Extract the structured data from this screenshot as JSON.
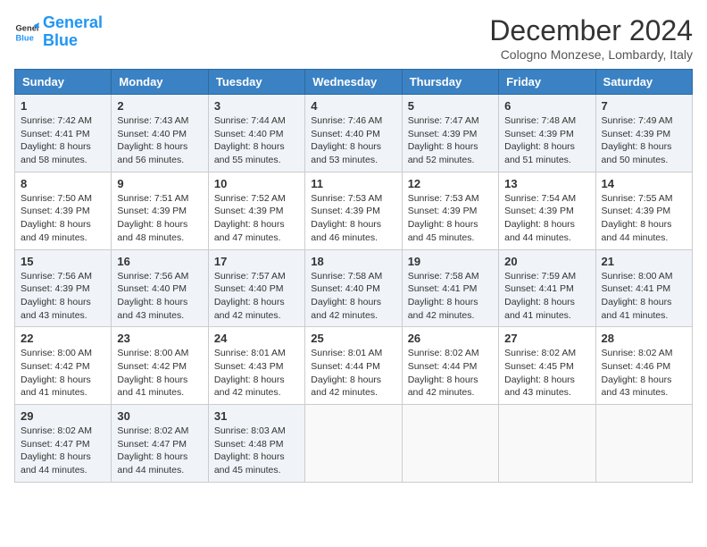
{
  "header": {
    "logo_line1": "General",
    "logo_line2": "Blue",
    "month_title": "December 2024",
    "location": "Cologno Monzese, Lombardy, Italy"
  },
  "weekdays": [
    "Sunday",
    "Monday",
    "Tuesday",
    "Wednesday",
    "Thursday",
    "Friday",
    "Saturday"
  ],
  "weeks": [
    [
      {
        "day": "1",
        "sunrise": "7:42 AM",
        "sunset": "4:41 PM",
        "daylight": "8 hours and 58 minutes."
      },
      {
        "day": "2",
        "sunrise": "7:43 AM",
        "sunset": "4:40 PM",
        "daylight": "8 hours and 56 minutes."
      },
      {
        "day": "3",
        "sunrise": "7:44 AM",
        "sunset": "4:40 PM",
        "daylight": "8 hours and 55 minutes."
      },
      {
        "day": "4",
        "sunrise": "7:46 AM",
        "sunset": "4:40 PM",
        "daylight": "8 hours and 53 minutes."
      },
      {
        "day": "5",
        "sunrise": "7:47 AM",
        "sunset": "4:39 PM",
        "daylight": "8 hours and 52 minutes."
      },
      {
        "day": "6",
        "sunrise": "7:48 AM",
        "sunset": "4:39 PM",
        "daylight": "8 hours and 51 minutes."
      },
      {
        "day": "7",
        "sunrise": "7:49 AM",
        "sunset": "4:39 PM",
        "daylight": "8 hours and 50 minutes."
      }
    ],
    [
      {
        "day": "8",
        "sunrise": "7:50 AM",
        "sunset": "4:39 PM",
        "daylight": "8 hours and 49 minutes."
      },
      {
        "day": "9",
        "sunrise": "7:51 AM",
        "sunset": "4:39 PM",
        "daylight": "8 hours and 48 minutes."
      },
      {
        "day": "10",
        "sunrise": "7:52 AM",
        "sunset": "4:39 PM",
        "daylight": "8 hours and 47 minutes."
      },
      {
        "day": "11",
        "sunrise": "7:53 AM",
        "sunset": "4:39 PM",
        "daylight": "8 hours and 46 minutes."
      },
      {
        "day": "12",
        "sunrise": "7:53 AM",
        "sunset": "4:39 PM",
        "daylight": "8 hours and 45 minutes."
      },
      {
        "day": "13",
        "sunrise": "7:54 AM",
        "sunset": "4:39 PM",
        "daylight": "8 hours and 44 minutes."
      },
      {
        "day": "14",
        "sunrise": "7:55 AM",
        "sunset": "4:39 PM",
        "daylight": "8 hours and 44 minutes."
      }
    ],
    [
      {
        "day": "15",
        "sunrise": "7:56 AM",
        "sunset": "4:39 PM",
        "daylight": "8 hours and 43 minutes."
      },
      {
        "day": "16",
        "sunrise": "7:56 AM",
        "sunset": "4:40 PM",
        "daylight": "8 hours and 43 minutes."
      },
      {
        "day": "17",
        "sunrise": "7:57 AM",
        "sunset": "4:40 PM",
        "daylight": "8 hours and 42 minutes."
      },
      {
        "day": "18",
        "sunrise": "7:58 AM",
        "sunset": "4:40 PM",
        "daylight": "8 hours and 42 minutes."
      },
      {
        "day": "19",
        "sunrise": "7:58 AM",
        "sunset": "4:41 PM",
        "daylight": "8 hours and 42 minutes."
      },
      {
        "day": "20",
        "sunrise": "7:59 AM",
        "sunset": "4:41 PM",
        "daylight": "8 hours and 41 minutes."
      },
      {
        "day": "21",
        "sunrise": "8:00 AM",
        "sunset": "4:41 PM",
        "daylight": "8 hours and 41 minutes."
      }
    ],
    [
      {
        "day": "22",
        "sunrise": "8:00 AM",
        "sunset": "4:42 PM",
        "daylight": "8 hours and 41 minutes."
      },
      {
        "day": "23",
        "sunrise": "8:00 AM",
        "sunset": "4:42 PM",
        "daylight": "8 hours and 41 minutes."
      },
      {
        "day": "24",
        "sunrise": "8:01 AM",
        "sunset": "4:43 PM",
        "daylight": "8 hours and 42 minutes."
      },
      {
        "day": "25",
        "sunrise": "8:01 AM",
        "sunset": "4:44 PM",
        "daylight": "8 hours and 42 minutes."
      },
      {
        "day": "26",
        "sunrise": "8:02 AM",
        "sunset": "4:44 PM",
        "daylight": "8 hours and 42 minutes."
      },
      {
        "day": "27",
        "sunrise": "8:02 AM",
        "sunset": "4:45 PM",
        "daylight": "8 hours and 43 minutes."
      },
      {
        "day": "28",
        "sunrise": "8:02 AM",
        "sunset": "4:46 PM",
        "daylight": "8 hours and 43 minutes."
      }
    ],
    [
      {
        "day": "29",
        "sunrise": "8:02 AM",
        "sunset": "4:47 PM",
        "daylight": "8 hours and 44 minutes."
      },
      {
        "day": "30",
        "sunrise": "8:02 AM",
        "sunset": "4:47 PM",
        "daylight": "8 hours and 44 minutes."
      },
      {
        "day": "31",
        "sunrise": "8:03 AM",
        "sunset": "4:48 PM",
        "daylight": "8 hours and 45 minutes."
      },
      null,
      null,
      null,
      null
    ]
  ]
}
